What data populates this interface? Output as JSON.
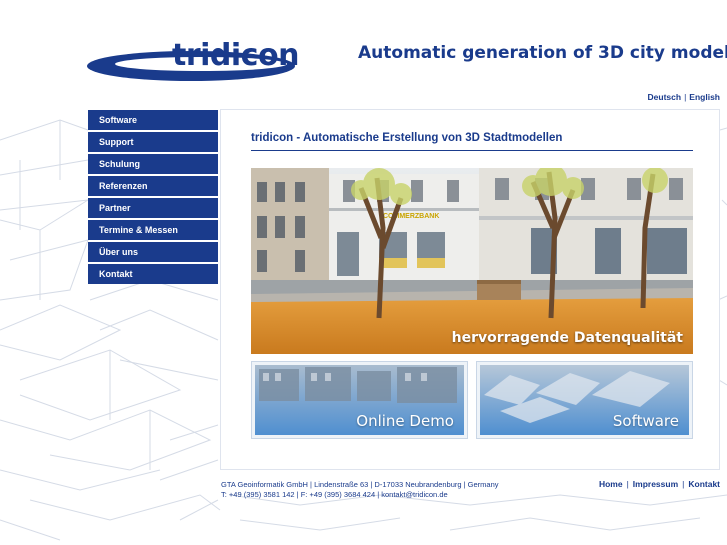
{
  "header": {
    "logo_text": "tridicon",
    "tagline": "Automatic generation of 3D city models",
    "languages": [
      "Deutsch",
      "English"
    ],
    "lang_separator": "|"
  },
  "nav": {
    "items": [
      {
        "label": "Software"
      },
      {
        "label": "Support"
      },
      {
        "label": "Schulung"
      },
      {
        "label": "Referenzen"
      },
      {
        "label": "Partner"
      },
      {
        "label": "Termine & Messen"
      },
      {
        "label": "Über uns"
      },
      {
        "label": "Kontakt"
      }
    ]
  },
  "main": {
    "title": "tridicon - Automatische Erstellung von 3D Stadtmodellen",
    "hero_caption": "hervorragende Datenqualität",
    "hero_signs": [
      "COMMERZBANK"
    ],
    "tiles": [
      {
        "label": "Online Demo"
      },
      {
        "label": "Software"
      }
    ]
  },
  "footer": {
    "address_line1": "GTA Geoinformatik GmbH | Lindenstraße 63 | D-17033 Neubrandenburg | Germany",
    "address_line2": "T: +49 (395) 3581 142 | F: +49 (395) 3684 424 | kontakt@tridicon.de",
    "links": [
      "Home",
      "Impressum",
      "Kontakt"
    ],
    "link_separator": "|"
  },
  "colors": {
    "brand_blue": "#1a3b8c",
    "panel_border": "#dfe4ee",
    "ground_orange": "#d98d2a"
  }
}
